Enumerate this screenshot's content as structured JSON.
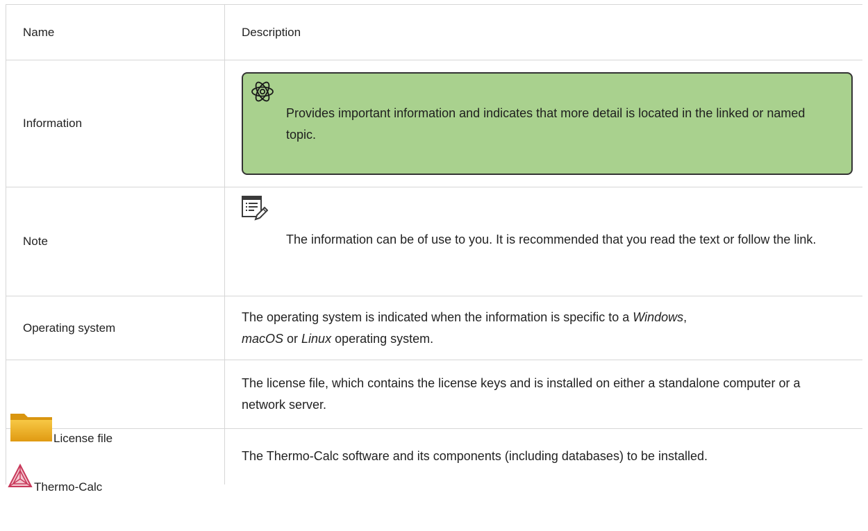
{
  "header": {
    "name": "Name",
    "description": "Description"
  },
  "rows": {
    "information": {
      "name": "Information",
      "description": "Provides important information and indicates that more detail is located in the linked or named topic.",
      "icon": "atom-icon",
      "box_color": "#a9d18e"
    },
    "note": {
      "name": "Note",
      "description": "The information can be of use to you. It is recommended that you read the text or follow the link.",
      "icon": "note-icon"
    },
    "operating_system": {
      "name": "Operating system",
      "desc_1": "The operating system is indicated when the information is specific to a ",
      "os_windows": "Windows",
      "sep_1": ", ",
      "os_macos": "macOS",
      "sep_2": " or ",
      "os_linux": "Linux",
      "desc_2": " operating system."
    },
    "license_file": {
      "name": "License file",
      "description": "The license file, which contains the license keys and is installed on either a standalone computer or a network server.",
      "icon": "folder-icon"
    },
    "thermo_calc": {
      "name": "Thermo-Calc",
      "description": "The Thermo-Calc software and its components (including databases) to be installed.",
      "icon": "thermo-calc-logo-icon"
    }
  }
}
